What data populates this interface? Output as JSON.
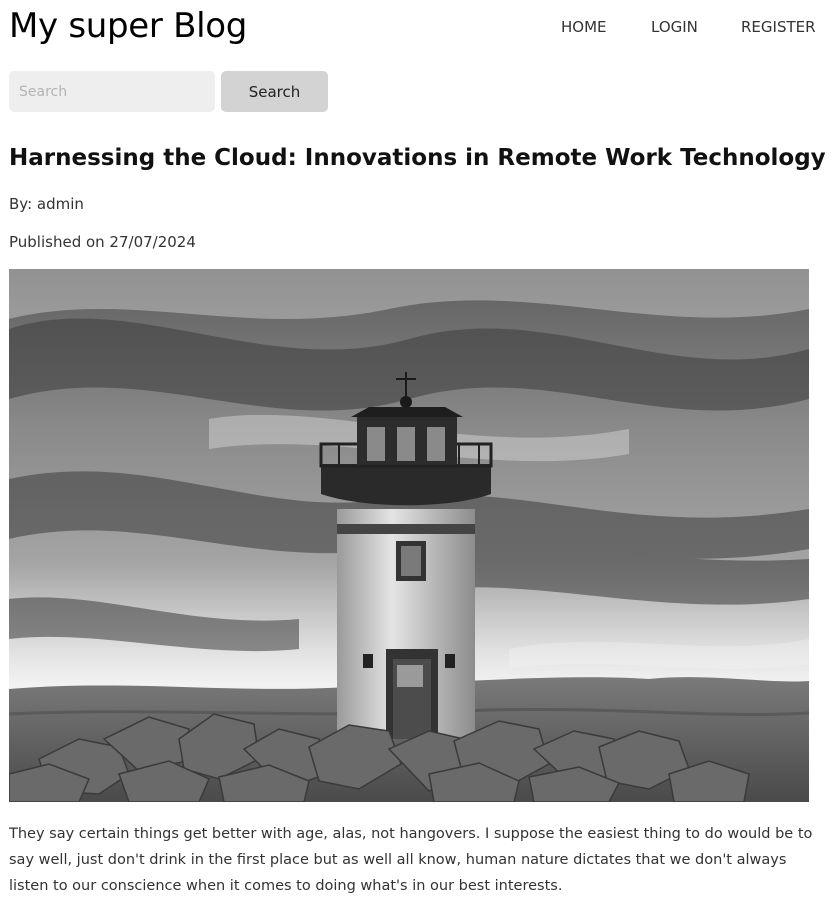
{
  "site": {
    "title": "My super Blog"
  },
  "nav": {
    "home": "HOME",
    "login": "LOGIN",
    "register": "REGISTER"
  },
  "search": {
    "placeholder": "Search",
    "value": "",
    "button_label": "Search"
  },
  "post": {
    "title": "Harnessing the Cloud: Innovations in Remote Work Technology",
    "author": "By: admin",
    "published": "Published on 27/07/2024",
    "image_subject": "black-and-white photograph of a lighthouse on rocks under a cloudy sky",
    "excerpt": "They say certain things get better with age, alas, not hangovers. I suppose the easiest thing to do would be to say well, just don't drink in the first place but as well all know, human nature dictates that we don't always listen to our conscience when it comes to doing what's in our best interests."
  },
  "colors": {
    "search_input_bg": "#eeeeee",
    "search_button_bg": "#d3d3d3",
    "text_primary": "#111111",
    "text_secondary": "#333333"
  }
}
